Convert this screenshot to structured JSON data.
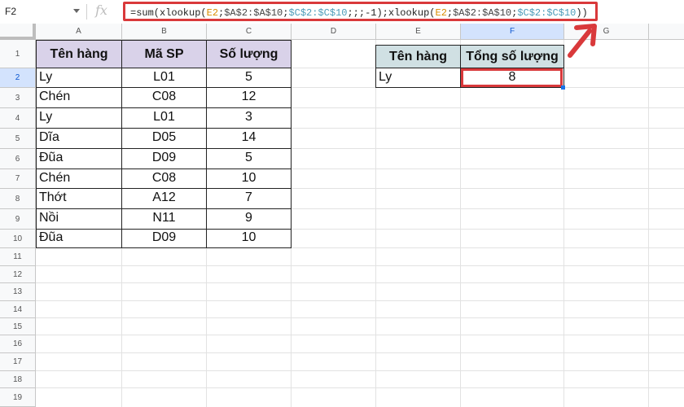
{
  "formula_bar": {
    "name_box": "F2",
    "fx_label": "fx",
    "formula_parts": {
      "p1": "=sum(xlookup(",
      "p2": "E2",
      "p3": ";",
      "p4": "$A$2:$A$10",
      "p5": ";",
      "p6": "$C$2:$C$10",
      "p7": ";;;-1);xlookup(",
      "p8": "E2",
      "p9": ";",
      "p10": "$A$2:$A$10",
      "p11": ";",
      "p12": "$C$2:$C$10",
      "p13": "))"
    }
  },
  "columns": [
    "A",
    "B",
    "C",
    "D",
    "E",
    "F",
    "G"
  ],
  "selected_cell": "F2",
  "rows": [
    "1",
    "2",
    "3",
    "4",
    "5",
    "6",
    "7",
    "8",
    "9",
    "10",
    "11",
    "12",
    "13",
    "14",
    "15",
    "16",
    "17",
    "18",
    "19"
  ],
  "table1": {
    "headers": [
      "Tên hàng",
      "Mã SP",
      "Số lượng"
    ],
    "rows": [
      [
        "Ly",
        "L01",
        "5"
      ],
      [
        "Chén",
        "C08",
        "12"
      ],
      [
        "Ly",
        "L01",
        "3"
      ],
      [
        "Dĩa",
        "D05",
        "14"
      ],
      [
        "Đũa",
        "D09",
        "5"
      ],
      [
        "Chén",
        "C08",
        "10"
      ],
      [
        "Thớt",
        "A12",
        "7"
      ],
      [
        "Nồi",
        "N11",
        "9"
      ],
      [
        "Đũa",
        "D09",
        "10"
      ]
    ]
  },
  "table2": {
    "headers": [
      "Tên hàng",
      "Tổng số lượng"
    ],
    "row": [
      "Ly",
      "8"
    ]
  },
  "colors": {
    "highlight": "#d9393b",
    "header_purple": "#d9d2e9",
    "header_teal": "#d0e0e3",
    "selection_blue": "#d3e3fd"
  }
}
